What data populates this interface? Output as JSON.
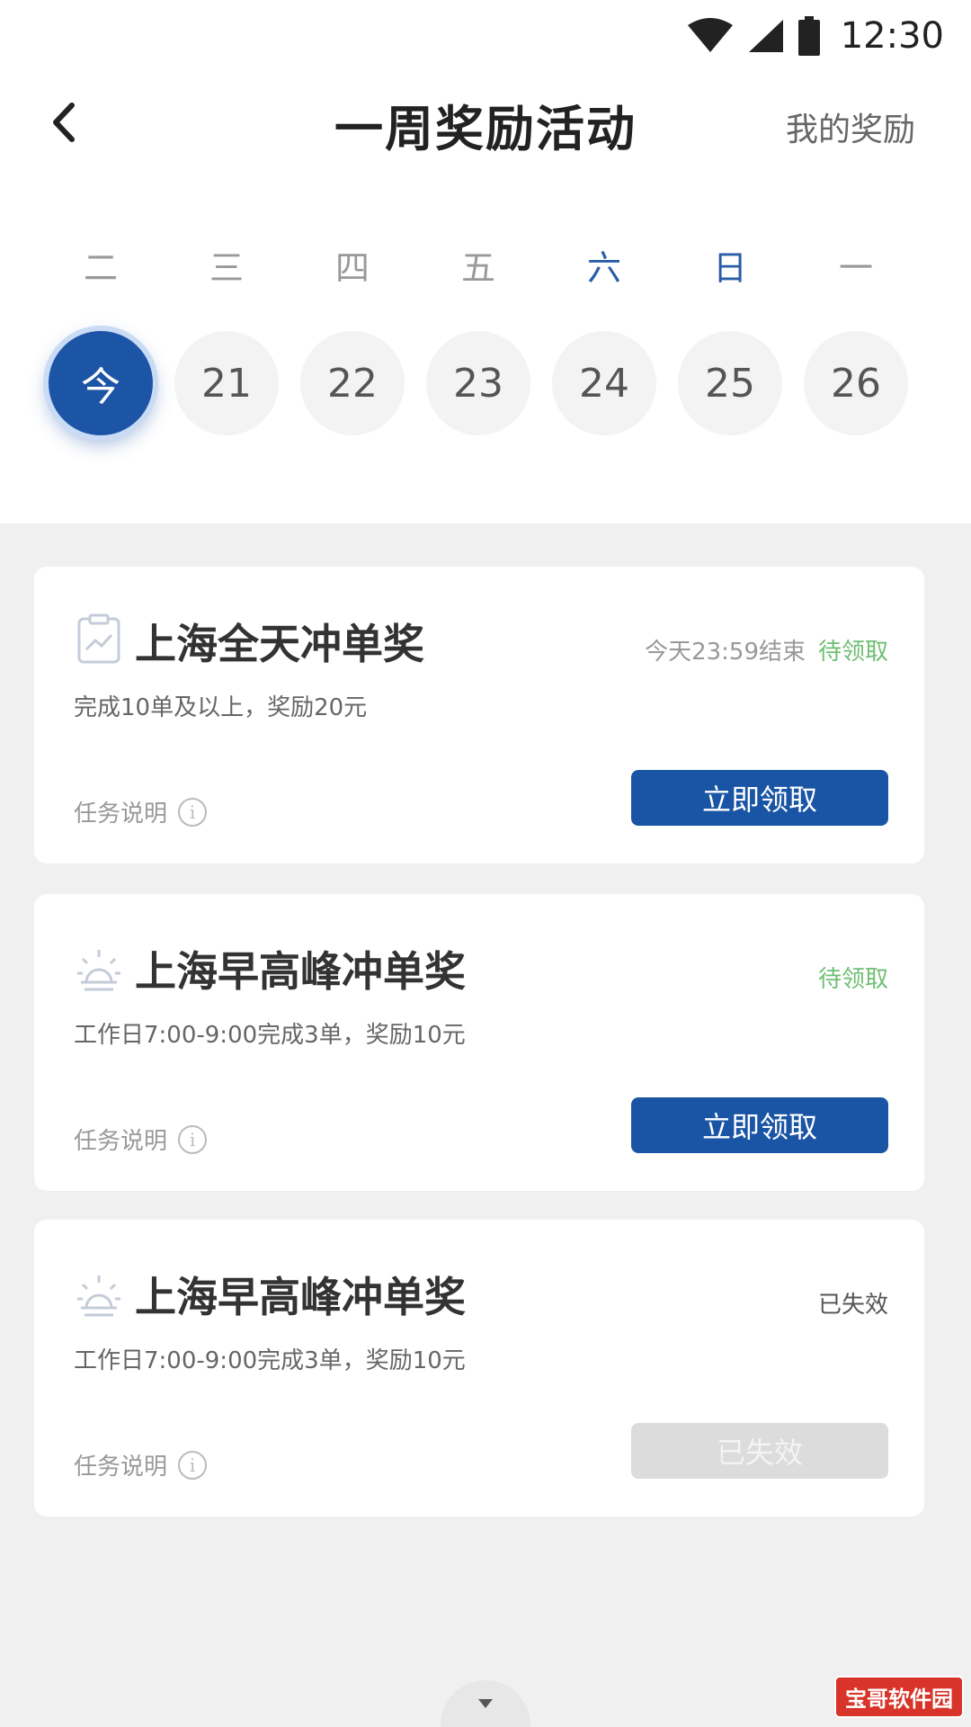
{
  "status_bar": {
    "time": "12:30",
    "icons": [
      "wifi-icon",
      "signal-icon",
      "battery-icon"
    ]
  },
  "nav": {
    "back_icon": "chevron-left-icon",
    "title": "一周奖励活动",
    "right_link": "我的奖励"
  },
  "week": {
    "days": [
      {
        "weekday": "二",
        "date": "今",
        "active": true,
        "weekend": false
      },
      {
        "weekday": "三",
        "date": "21",
        "active": false,
        "weekend": false
      },
      {
        "weekday": "四",
        "date": "22",
        "active": false,
        "weekend": false
      },
      {
        "weekday": "五",
        "date": "23",
        "active": false,
        "weekend": false
      },
      {
        "weekday": "六",
        "date": "24",
        "active": false,
        "weekend": true
      },
      {
        "weekday": "日",
        "date": "25",
        "active": false,
        "weekend": true
      },
      {
        "weekday": "一",
        "date": "26",
        "active": false,
        "weekend": false
      }
    ]
  },
  "cards": [
    {
      "icon": "clipboard-chart-icon",
      "title": "上海全天冲单奖",
      "desc": "完成10单及以上，奖励20元",
      "deadline": "今天23:59结束",
      "status": "待领取",
      "task_info": "任务说明",
      "button": "立即领取"
    },
    {
      "icon": "sunrise-icon",
      "title": "上海早高峰冲单奖",
      "desc": "工作日7:00-9:00完成3单，奖励10元",
      "deadline": "",
      "status": "待领取",
      "task_info": "任务说明",
      "button": "立即领取"
    },
    {
      "icon": "sunrise-icon",
      "title": "上海早高峰冲单奖",
      "desc": "工作日7:00-9:00完成3单，奖励10元",
      "deadline": "",
      "status": "已失效",
      "task_info": "任务说明",
      "button": "已失效"
    }
  ],
  "watermark": "宝哥软件园",
  "colors": {
    "primary": "#1a55a5",
    "pending": "#6fbf73",
    "weekend": "#2a5da8",
    "disabled": "#dcdcdc"
  }
}
